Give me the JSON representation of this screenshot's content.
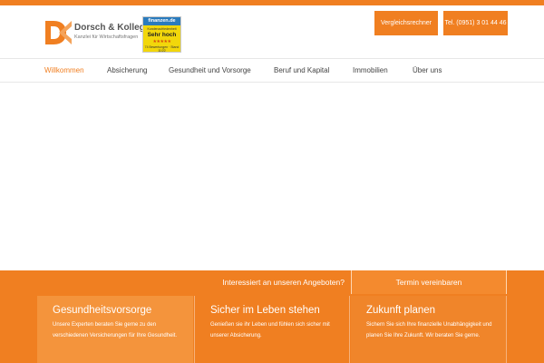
{
  "brand": {
    "name": "Dorsch & Kollegen",
    "tagline": "Kanzlei für Wirtschaftsfragen",
    "accent_color": "#f07f21"
  },
  "seal": {
    "source": "finanzen.de",
    "caption": "Kundenzufriedenheit",
    "grade": "Sehr hoch",
    "stars": "★★★★★",
    "footer": "74 Bewertungen · Stand 11/22"
  },
  "header_buttons": {
    "calculator": "Vergleichsrechner",
    "phone": "Tel. (0951) 3 01 44 46"
  },
  "nav": {
    "items": [
      {
        "label": "Willkommen",
        "active": true
      },
      {
        "label": "Absicherung",
        "active": false
      },
      {
        "label": "Gesundheit und Vorsorge",
        "active": false
      },
      {
        "label": "Beruf und Kapital",
        "active": false
      },
      {
        "label": "Immobilien",
        "active": false
      },
      {
        "label": "Über uns",
        "active": false
      }
    ]
  },
  "cta": {
    "question": "Interessiert an unseren Angeboten?",
    "button": "Termin vereinbaren"
  },
  "cards": [
    {
      "title": "Gesundheitsvorsorge",
      "text": "Unsere Experten beraten Sie gerne zu den verschiedenen Versicherungen für Ihre Gesundheit."
    },
    {
      "title": "Sicher im Leben stehen",
      "text": "Genießen sie ihr Leben und fühlen sich sicher mit unserer Absicherung."
    },
    {
      "title": "Zukunft planen",
      "text": "Sichern Sie sich Ihre finanzielle Unabhängigkeit und planen Sie Ihre Zukunft. Wir beraten Sie gerne."
    }
  ]
}
